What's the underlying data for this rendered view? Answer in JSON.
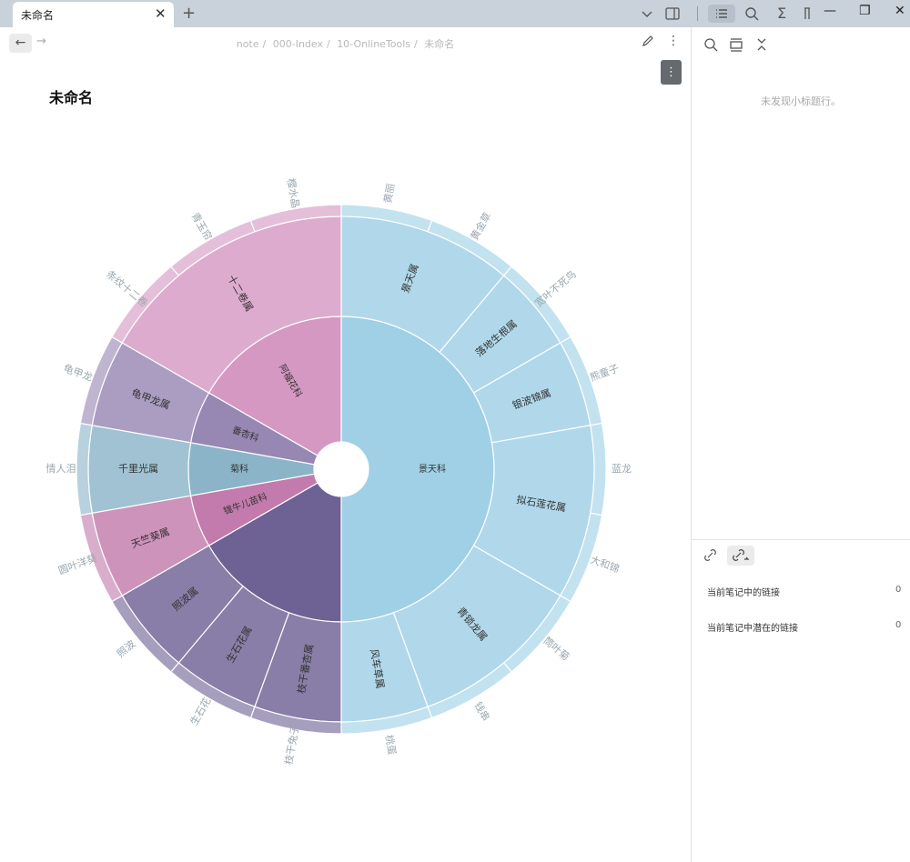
{
  "tab": {
    "title": "未命名"
  },
  "nav": {
    "breadcrumb": [
      "note",
      "000-Index",
      "10-OnlineTools",
      "未命名"
    ]
  },
  "note": {
    "title": "未命名"
  },
  "outline": {
    "empty_message": "未发现小标题行。"
  },
  "links": {
    "rows": [
      {
        "label": "当前笔记中的链接",
        "count": "0"
      },
      {
        "label": "当前笔记中潜在的链接",
        "count": "0"
      }
    ]
  },
  "icons": {
    "tabbar": [
      "chevron-down-icon",
      "sidebar-toggle-icon",
      "outline-icon",
      "search-icon",
      "sigma-icon",
      "pin-icon"
    ],
    "window": [
      "minimize-icon",
      "restore-icon",
      "close-icon"
    ],
    "right_panel": [
      "search-icon",
      "layout-icon",
      "collapse-icon"
    ]
  },
  "chart_data": {
    "type": "sunburst",
    "levels": [
      "科",
      "属",
      "种"
    ],
    "families": [
      {
        "name": "景天科",
        "color": "#9fd0e5",
        "children": [
          {
            "name": "景天属",
            "leaves": [
              "黄丽",
              "黄金草"
            ]
          },
          {
            "name": "落地生根属",
            "leaves": [
              "宽叶不死鸟"
            ]
          },
          {
            "name": "银波锦属",
            "leaves": [
              "熊童子"
            ]
          },
          {
            "name": "拟石莲花属",
            "leaves": [
              "蓝龙",
              "大和锦"
            ]
          },
          {
            "name": "青锁龙属",
            "leaves": [
              "筒叶菊",
              "钱串"
            ]
          },
          {
            "name": "风车草属",
            "leaves": [
              "桃蛋"
            ]
          }
        ]
      },
      {
        "name": "番杏科",
        "color": "#6e6294",
        "children": [
          {
            "name": "枝干番杏属",
            "leaves": [
              "枝干兔子"
            ]
          },
          {
            "name": "生石花属",
            "leaves": [
              "生石花"
            ]
          },
          {
            "name": "照波属",
            "leaves": [
              "照波"
            ]
          }
        ]
      },
      {
        "name": "牻牛儿苗科",
        "color": "#c27bac",
        "children": [
          {
            "name": "天竺葵属",
            "leaves": [
              "圆叶洋葵"
            ]
          }
        ]
      },
      {
        "name": "菊科",
        "color": "#8bb4c9",
        "children": [
          {
            "name": "千里光属",
            "leaves": [
              "情人泪"
            ]
          }
        ]
      },
      {
        "name": "番杏科",
        "color": "#9787b3",
        "children": [
          {
            "name": "龟甲龙属",
            "leaves": [
              "龟甲龙"
            ]
          }
        ]
      },
      {
        "name": "阿福花科",
        "color": "#d598c3",
        "children": [
          {
            "name": "十二卷属",
            "leaves": [
              "条纹十二卷",
              "青玉帘",
              "樱水晶"
            ]
          }
        ]
      }
    ]
  }
}
